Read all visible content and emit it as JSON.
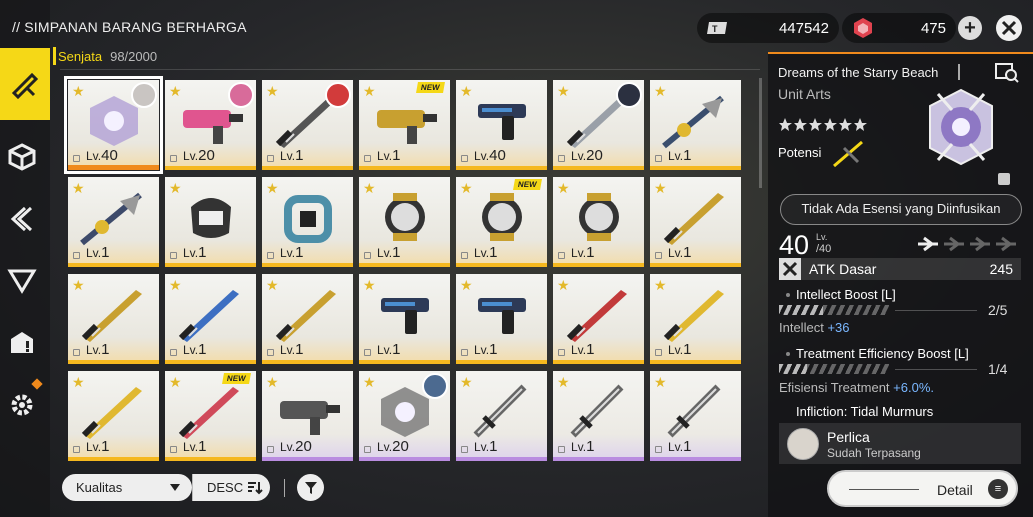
{
  "header": {
    "title": "// SIMPANAN BARANG BERHARGA",
    "tab_name": "Senjata",
    "tab_count": "98/2000"
  },
  "currency": [
    {
      "icon": "ticket-icon",
      "value": "447542"
    },
    {
      "icon": "origeometry-icon",
      "value": "475"
    }
  ],
  "sidebar": {
    "items": [
      {
        "icon": "weapon-icon",
        "active": true
      },
      {
        "icon": "cube-icon",
        "active": false
      },
      {
        "icon": "arrow-icon",
        "active": false
      },
      {
        "icon": "triangle-icon",
        "active": false
      },
      {
        "icon": "box-alert-icon",
        "active": false
      },
      {
        "icon": "gear-icon",
        "active": false
      }
    ]
  },
  "weapons": [
    {
      "lv": "40",
      "rarity": "orange",
      "avatar": "#c9c5c2",
      "new": false,
      "color": "#b2a0d6",
      "shape": "orb"
    },
    {
      "lv": "20",
      "rarity": "gold",
      "avatar": "#d86b9a",
      "new": false,
      "color": "#e0558f",
      "shape": "gun"
    },
    {
      "lv": "1",
      "rarity": "gold",
      "avatar": "#d23b3b",
      "new": false,
      "color": "#555",
      "shape": "blade"
    },
    {
      "lv": "1",
      "rarity": "gold",
      "avatar": "",
      "new": true,
      "color": "#c8a030",
      "shape": "gun"
    },
    {
      "lv": "40",
      "rarity": "gold",
      "avatar": "",
      "new": false,
      "color": "#2d3a57",
      "shape": "pistol"
    },
    {
      "lv": "20",
      "rarity": "gold",
      "avatar": "#2b3040",
      "new": false,
      "color": "#9aa0a8",
      "shape": "blade"
    },
    {
      "lv": "1",
      "rarity": "gold",
      "avatar": "",
      "new": false,
      "color": "#3a4e6e",
      "shape": "spear"
    },
    {
      "lv": "1",
      "rarity": "gold",
      "avatar": "",
      "new": false,
      "color": "#3d4a6a",
      "shape": "spear"
    },
    {
      "lv": "1",
      "rarity": "gold",
      "avatar": "",
      "new": false,
      "color": "#333",
      "shape": "bracer"
    },
    {
      "lv": "1",
      "rarity": "gold",
      "avatar": "",
      "new": false,
      "color": "#4d8fa8",
      "shape": "ring"
    },
    {
      "lv": "1",
      "rarity": "gold",
      "avatar": "",
      "new": false,
      "color": "#c8a030",
      "shape": "cage"
    },
    {
      "lv": "1",
      "rarity": "gold",
      "avatar": "",
      "new": true,
      "color": "#c8a030",
      "shape": "cage"
    },
    {
      "lv": "1",
      "rarity": "gold",
      "avatar": "",
      "new": false,
      "color": "#c8a030",
      "shape": "cage"
    },
    {
      "lv": "1",
      "rarity": "gold",
      "avatar": "",
      "new": false,
      "color": "#c8a030",
      "shape": "blade"
    },
    {
      "lv": "1",
      "rarity": "gold",
      "avatar": "",
      "new": false,
      "color": "#c8a030",
      "shape": "blade"
    },
    {
      "lv": "1",
      "rarity": "gold",
      "avatar": "",
      "new": false,
      "color": "#3d6fc2",
      "shape": "blade"
    },
    {
      "lv": "1",
      "rarity": "gold",
      "avatar": "",
      "new": false,
      "color": "#c8a030",
      "shape": "blade"
    },
    {
      "lv": "1",
      "rarity": "gold",
      "avatar": "",
      "new": false,
      "color": "#2d3a57",
      "shape": "pistol"
    },
    {
      "lv": "1",
      "rarity": "gold",
      "avatar": "",
      "new": false,
      "color": "#2d3a57",
      "shape": "pistol"
    },
    {
      "lv": "1",
      "rarity": "gold",
      "avatar": "",
      "new": false,
      "color": "#c23a3a",
      "shape": "blade"
    },
    {
      "lv": "1",
      "rarity": "gold",
      "avatar": "",
      "new": false,
      "color": "#e0b830",
      "shape": "blade"
    },
    {
      "lv": "1",
      "rarity": "gold",
      "avatar": "",
      "new": false,
      "color": "#e0b830",
      "shape": "blade"
    },
    {
      "lv": "1",
      "rarity": "gold",
      "avatar": "",
      "new": true,
      "color": "#d04a5a",
      "shape": "blade"
    },
    {
      "lv": "20",
      "rarity": "purple",
      "avatar": "",
      "new": false,
      "color": "#555",
      "shape": "gun"
    },
    {
      "lv": "20",
      "rarity": "purple",
      "avatar": "#4c6a90",
      "new": false,
      "color": "#777",
      "shape": "orb"
    },
    {
      "lv": "1",
      "rarity": "purple",
      "avatar": "",
      "new": false,
      "color": "#666",
      "shape": "sword"
    },
    {
      "lv": "1",
      "rarity": "purple",
      "avatar": "",
      "new": false,
      "color": "#666",
      "shape": "sword"
    },
    {
      "lv": "1",
      "rarity": "purple",
      "avatar": "",
      "new": false,
      "color": "#666",
      "shape": "sword"
    }
  ],
  "labels": {
    "lv_prefix": "Lv.",
    "new_badge": "NEW"
  },
  "bottom": {
    "sort_value": "Kualitas",
    "order_label": "DESC"
  },
  "detail": {
    "weapon_name": "Dreams of the Starry Beach",
    "weapon_type": "Unit Arts",
    "potensi_label": "Potensi",
    "essence_button": "Tidak Ada Esensi yang Diinfusikan",
    "level": "40",
    "level_tag": "Lv.",
    "level_max": "/40",
    "atk_label": "ATK Dasar",
    "atk_value": "245",
    "skills": [
      {
        "name": "Intellect Boost [L]",
        "frac": "2/5",
        "progress": 0.4,
        "effect_label": "Intellect",
        "effect_value": "+36"
      },
      {
        "name": "Treatment Efficiency Boost [L]",
        "frac": "1/4",
        "progress": 0.25,
        "effect_label": "Efisiensi Treatment",
        "effect_value": "+6.0%."
      },
      {
        "name": "Infliction: Tidal Murmurs"
      }
    ],
    "equipped_name": "Perlica",
    "equipped_status": "Sudah Terpasang",
    "detail_button": "Detail"
  },
  "colors": {
    "accent": "#f5d817",
    "orange": "#f08a1c",
    "gold_bar": "#f5b81f",
    "purple_bar": "#b98ce0",
    "effect_value": "#7ab7ff"
  }
}
